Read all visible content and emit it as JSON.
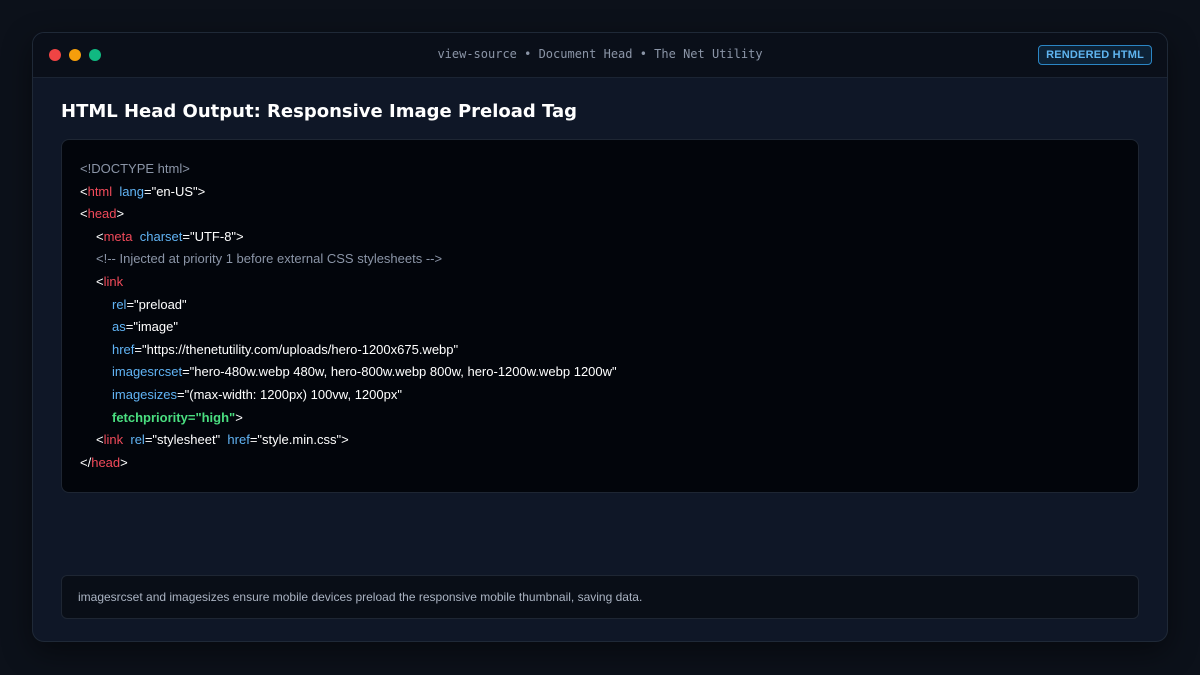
{
  "window": {
    "title": "view-source • Document Head • The Net Utility",
    "badge": "RENDERED HTML"
  },
  "heading": "HTML Head Output: Responsive Image Preload Tag",
  "code": {
    "doctype": "<!DOCTYPE html>",
    "html_tag": "html",
    "lang_attr": "lang",
    "lang_value": "\"en-US\"",
    "head_tag": "head",
    "meta_tag": "meta",
    "charset_attr": "charset",
    "charset_value": "\"UTF-8\"",
    "comment": "<!-- Injected at priority 1 before external CSS stylesheets -->",
    "link_tag": "link",
    "rel_attr": "rel",
    "rel_value": "\"preload\"",
    "as_attr": "as",
    "as_value": "\"image\"",
    "href_attr": "href",
    "href_value": "\"https://thenetutility.com/uploads/hero-1200x675.webp\"",
    "imagesrcset_attr": "imagesrcset",
    "imagesrcset_value": "\"hero-480w.webp 480w, hero-800w.webp 800w, hero-1200w.webp 1200w\"",
    "imagesizes_attr": "imagesizes",
    "imagesizes_value": "\"(max-width: 1200px) 100vw, 1200px\"",
    "fetchpriority_attr": "fetchpriority",
    "fetchpriority_value": "\"high\"",
    "stylesheet_rel_value": "\"stylesheet\"",
    "stylesheet_href_value": "\"style.min.css\""
  },
  "note": "imagesrcset and imagesizes ensure mobile devices preload the responsive mobile thumbnail, saving data.",
  "colors": {
    "tag": "#f04a5a",
    "attribute": "#61b4f5",
    "highlight": "#4ade80",
    "comment": "#8b95a7",
    "badge": "#5fb4ef"
  }
}
